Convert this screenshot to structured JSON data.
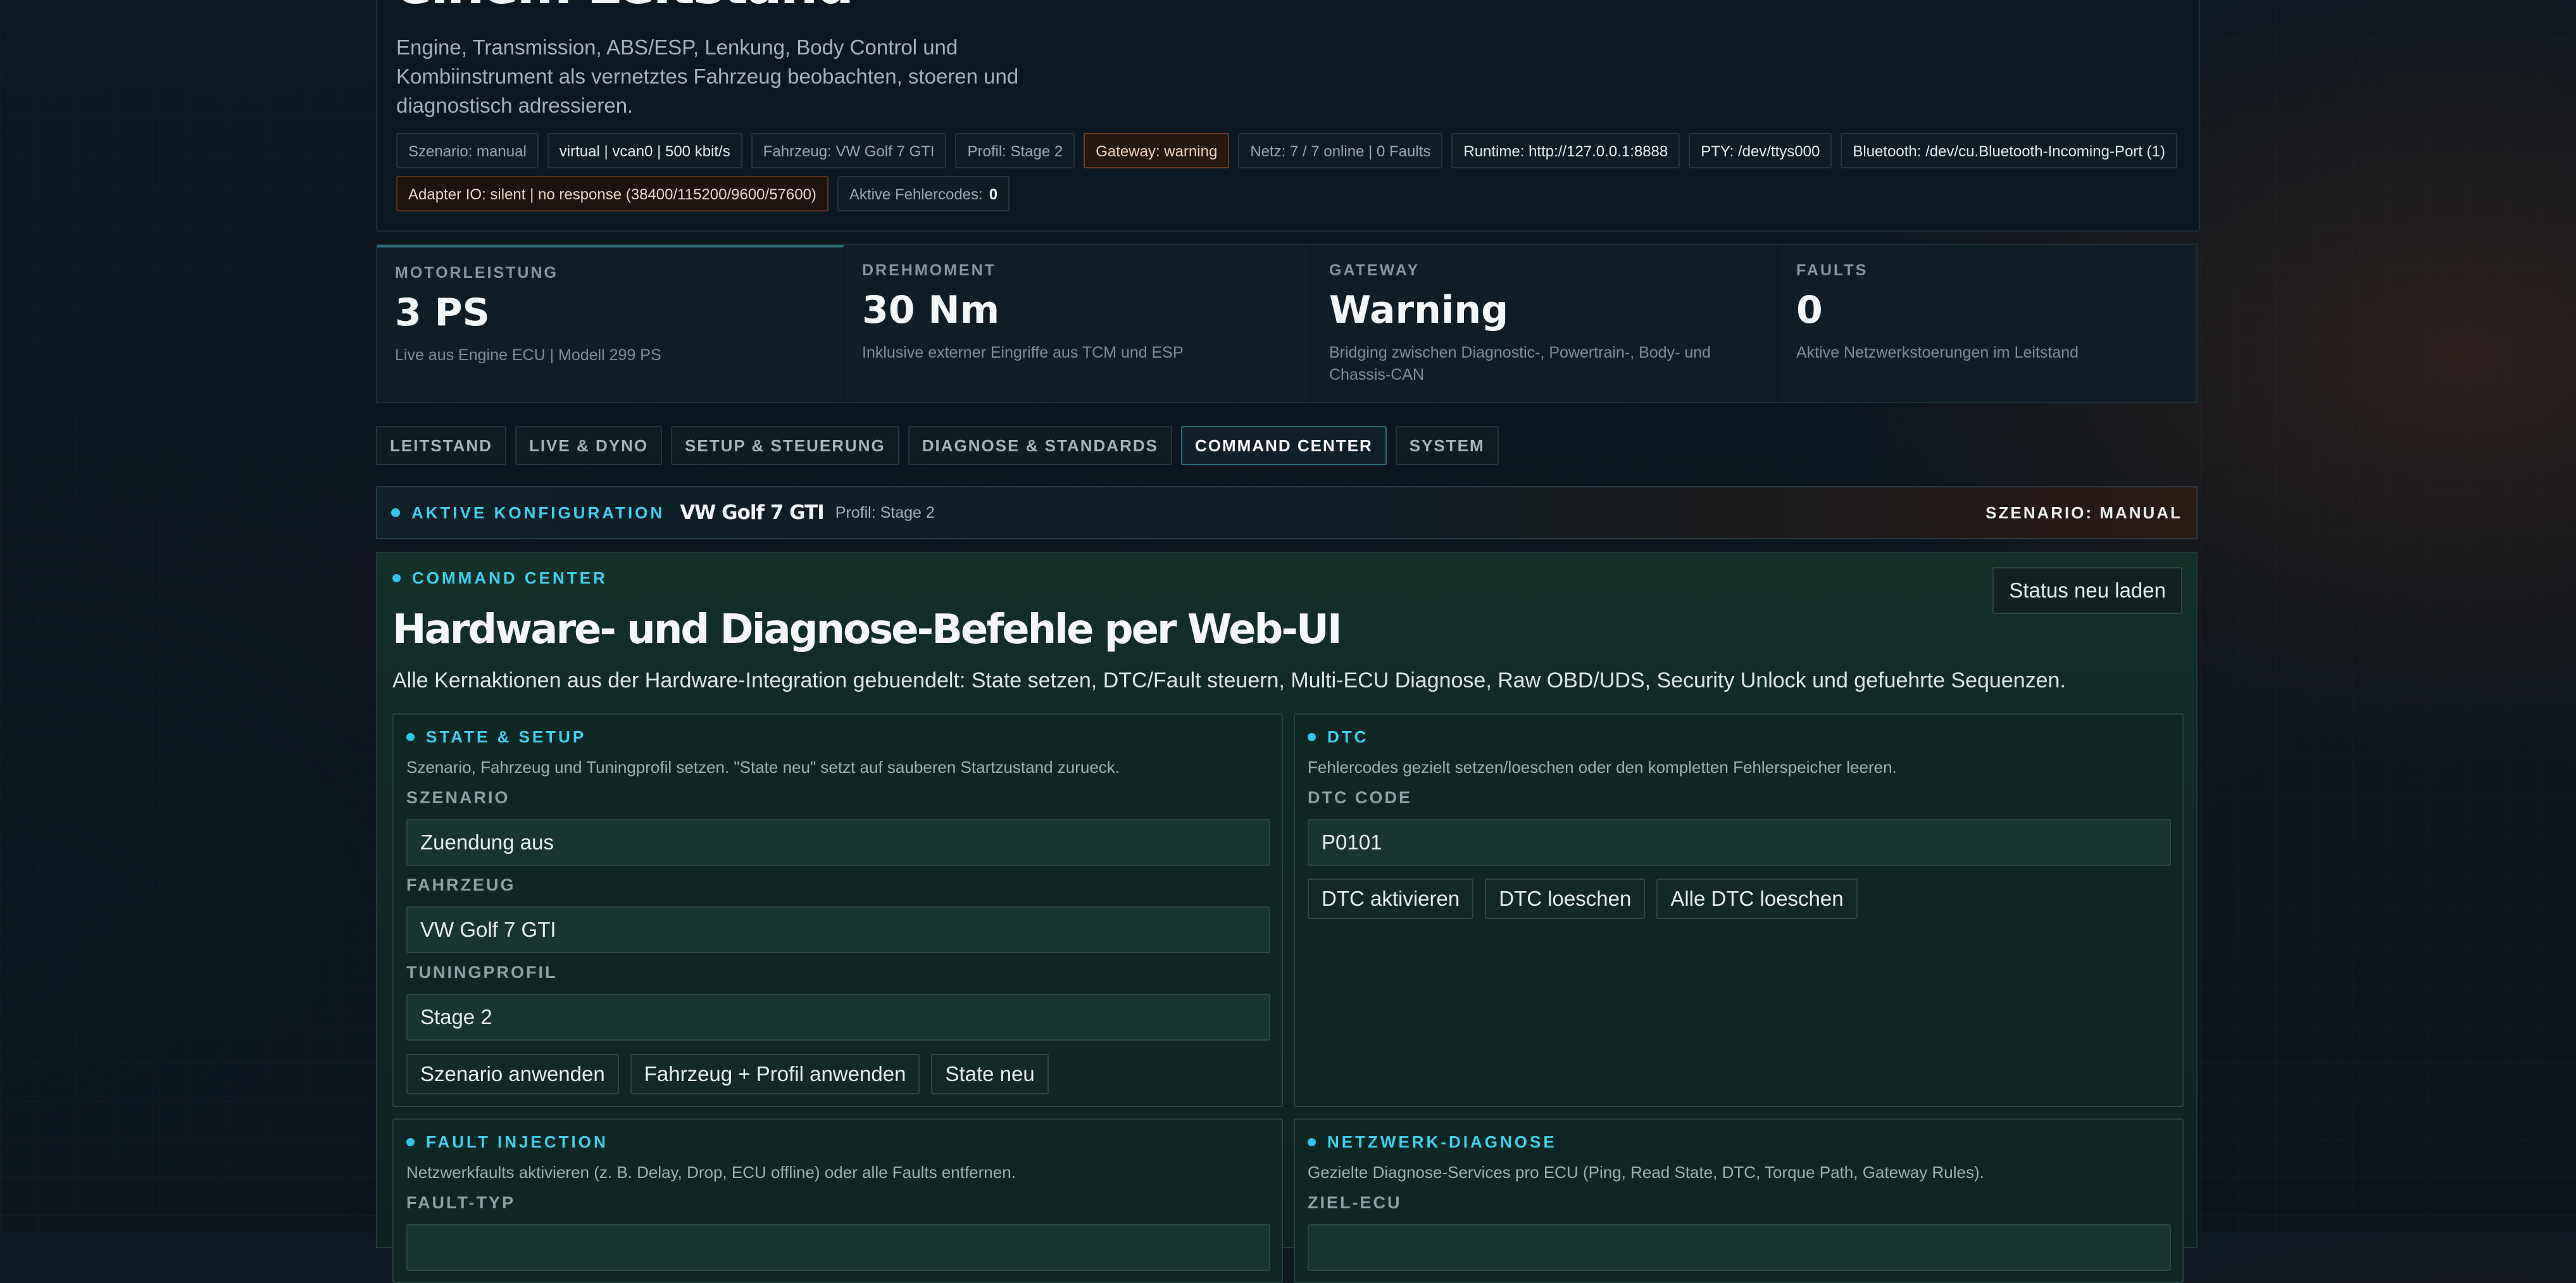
{
  "hero": {
    "title": "einem Leitstand",
    "subtitle": "Engine, Transmission, ABS/ESP, Lenkung, Body Control und Kombiinstrument als vernetztes Fahrzeug beobachten, stoeren und diagnostisch adressieren.",
    "chips": [
      {
        "text": "Szenario: manual",
        "style": "normal"
      },
      {
        "text": "virtual | vcan0 | 500 kbit/s",
        "style": "bright"
      },
      {
        "text": "Fahrzeug: VW Golf 7 GTI",
        "style": "normal"
      },
      {
        "text": "Profil: Stage 2",
        "style": "normal"
      },
      {
        "text": "Gateway: warning",
        "style": "warn"
      },
      {
        "text": "Netz: 7 / 7 online | 0 Faults",
        "style": "normal"
      },
      {
        "text": "Runtime: http://127.0.0.1:8888",
        "style": "bright"
      },
      {
        "text": "PTY: /dev/ttys000",
        "style": "bright"
      },
      {
        "text": "Bluetooth: /dev/cu.Bluetooth-Incoming-Port (1)",
        "style": "bright"
      }
    ],
    "adapter_chip": "Adapter IO: silent | no response (38400/115200/9600/57600)",
    "fault_chip": {
      "label": "Aktive Fehlercodes:",
      "value": "0"
    }
  },
  "metrics": [
    {
      "label": "MOTORLEISTUNG",
      "value": "3 PS",
      "desc": "Live aus Engine ECU | Modell 299 PS"
    },
    {
      "label": "DREHMOMENT",
      "value": "30 Nm",
      "desc": "Inklusive externer Eingriffe aus TCM und ESP"
    },
    {
      "label": "GATEWAY",
      "value": "Warning",
      "desc": "Bridging zwischen Diagnostic-, Powertrain-, Body- und Chassis-CAN"
    },
    {
      "label": "FAULTS",
      "value": "0",
      "desc": "Aktive Netzwerkstoerungen im Leitstand"
    }
  ],
  "tabs": [
    "LEITSTAND",
    "LIVE & DYNO",
    "SETUP & STEUERUNG",
    "DIAGNOSE & STANDARDS",
    "COMMAND CENTER",
    "SYSTEM"
  ],
  "active_tab": "COMMAND CENTER",
  "config": {
    "label": "AKTIVE KONFIGURATION",
    "vehicle": "VW Golf 7 GTI",
    "profile": "Profil: Stage 2",
    "scenario": "SZENARIO: MANUAL"
  },
  "command_center": {
    "label": "COMMAND CENTER",
    "title": "Hardware- und Diagnose-Befehle per Web-UI",
    "description": "Alle Kernaktionen aus der Hardware-Integration gebuendelt: State setzen, DTC/Fault steuern, Multi-ECU Diagnose, Raw OBD/UDS, Security Unlock und gefuehrte Sequenzen.",
    "reload_button": "Status neu laden",
    "state_setup": {
      "label": "STATE & SETUP",
      "desc": "Szenario, Fahrzeug und Tuningprofil setzen. \"State neu\" setzt auf sauberen Startzustand zurueck.",
      "szenario_label": "SZENARIO",
      "szenario_value": "Zuendung aus",
      "fahrzeug_label": "FAHRZEUG",
      "fahrzeug_value": "VW Golf 7 GTI",
      "tuning_label": "TUNINGPROFIL",
      "tuning_value": "Stage 2",
      "buttons": {
        "apply_scenario": "Szenario anwenden",
        "apply_vehicle": "Fahrzeug + Profil anwenden",
        "state_reset": "State neu"
      }
    },
    "dtc": {
      "label": "DTC",
      "desc": "Fehlercodes gezielt setzen/loeschen oder den kompletten Fehlerspeicher leeren.",
      "code_label": "DTC CODE",
      "code_value": "P0101",
      "buttons": {
        "activate": "DTC aktivieren",
        "clear": "DTC loeschen",
        "clear_all": "Alle DTC loeschen"
      }
    },
    "fault_injection": {
      "label": "FAULT INJECTION",
      "desc": "Netzwerkfaults aktivieren (z. B. Delay, Drop, ECU offline) oder alle Faults entfernen.",
      "type_label": "FAULT-TYP"
    },
    "network_diag": {
      "label": "NETZWERK-DIAGNOSE",
      "desc": "Gezielte Diagnose-Services pro ECU (Ping, Read State, DTC, Torque Path, Gateway Rules).",
      "target_label": "ZIEL-ECU"
    }
  }
}
